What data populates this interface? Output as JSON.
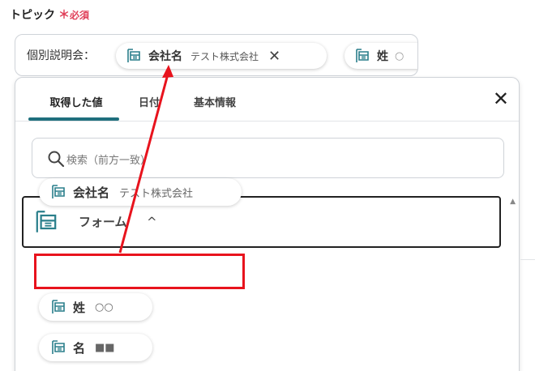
{
  "field": {
    "label": "トピック",
    "required_mark": "＊",
    "required_text": "必須",
    "prefix_text": "個別説明会：",
    "chips": [
      {
        "name": "会社名",
        "value": "テスト株式会社",
        "close": "✕"
      },
      {
        "name": "姓",
        "value": "○"
      }
    ]
  },
  "dropdown": {
    "tabs": [
      {
        "label": "取得した値"
      },
      {
        "label": "日付"
      },
      {
        "label": "基本情報"
      }
    ],
    "close": "✕",
    "search": {
      "placeholder": "検索（前方一致）"
    },
    "scroll_up": "▲",
    "group": {
      "label": "フォーム",
      "chevron": "^"
    },
    "items": [
      {
        "name": "会社名",
        "value": "テスト株式会社"
      },
      {
        "name": "姓",
        "value": "○○"
      },
      {
        "name": "名",
        "value": "■■"
      }
    ]
  },
  "colors": {
    "required": "#e0405a",
    "tab_underline": "#1f6f7d",
    "annotation": "#e8131d"
  }
}
